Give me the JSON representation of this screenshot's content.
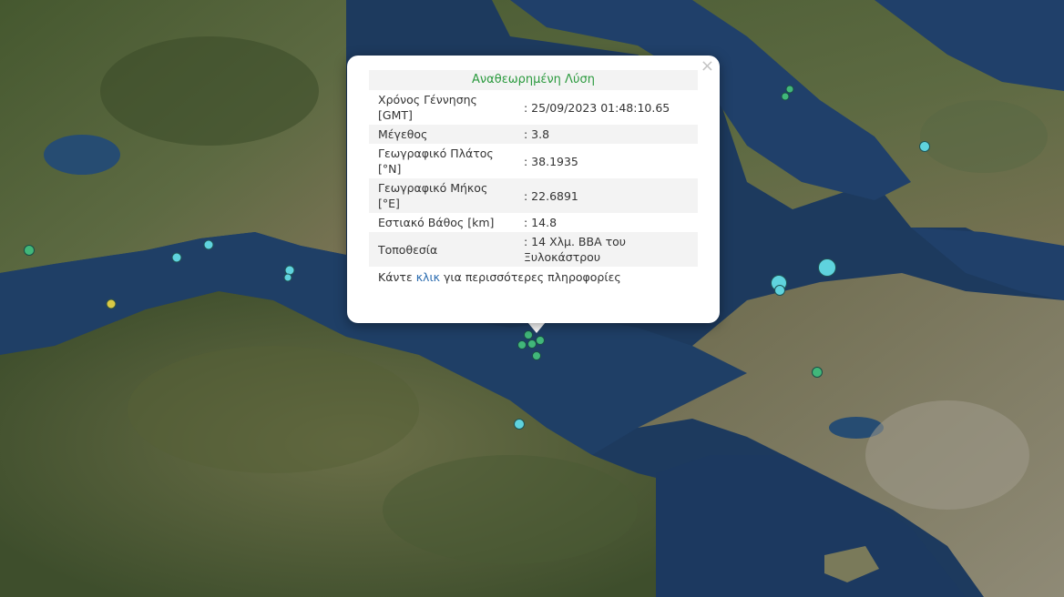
{
  "popup": {
    "title": "Αναθεωρημένη Λύση",
    "close_icon": "×",
    "rows": [
      {
        "label": "Χρόνος Γέννησης [GMT]",
        "value": ": 25/09/2023 01:48:10.65"
      },
      {
        "label": "Μέγεθος",
        "value": ": 3.8"
      },
      {
        "label": "Γεωγραφικό Πλάτος [°N]",
        "value": ": 38.1935"
      },
      {
        "label": "Γεωγραφικό Μήκος [°E]",
        "value": ": 22.6891"
      },
      {
        "label": "Εστιακό Βάθος [km]",
        "value": ": 14.8"
      },
      {
        "label": "Τοποθεσία",
        "value": ": 14 Χλμ. ΒΒΑ του Ξυλοκάστρου"
      }
    ],
    "more_prefix": "Κάντε ",
    "more_link": "κλικ",
    "more_suffix": " για περισσότερες πληροφορίες"
  },
  "colors": {
    "sea": "#1d3a5e",
    "land": "#4a5a34",
    "marker_cyan": "#5fd3de",
    "marker_green": "#41b77a",
    "marker_yellow": "#d9c845",
    "title_green": "#2b9a3e",
    "link_blue": "#2b6cb0"
  }
}
